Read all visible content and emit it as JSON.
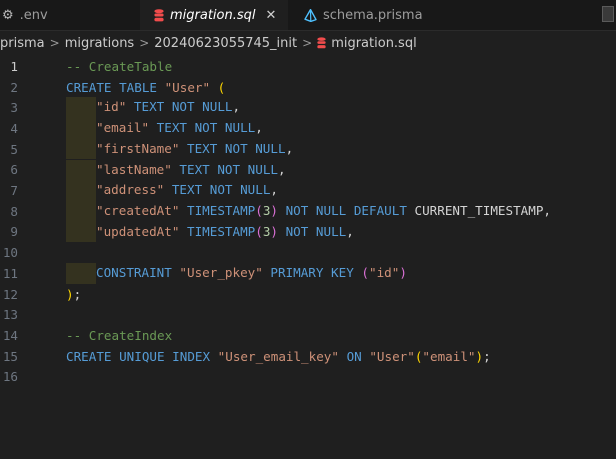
{
  "tabs": [
    {
      "label": ".env",
      "icon": "gear-icon",
      "active": false
    },
    {
      "label": "migration.sql",
      "icon": "database-icon",
      "active": true,
      "close": "✕"
    },
    {
      "label": "schema.prisma",
      "icon": "prisma-icon",
      "active": false
    }
  ],
  "breadcrumb": {
    "items": [
      "prisma",
      "migrations",
      "20240623055745_init",
      "migration.sql"
    ],
    "separator": ">"
  },
  "colors": {
    "keyword": "#569cd6",
    "string": "#ce9178",
    "comment": "#6a9955",
    "bracket": "#ffd700",
    "db_icon": "#f14c4c",
    "prisma_icon": "#4fc1ff"
  },
  "editor": {
    "current_line": 1,
    "lines": [
      {
        "n": "1",
        "tokens": [
          [
            "-- CreateTable",
            "comment"
          ]
        ]
      },
      {
        "n": "2",
        "tokens": [
          [
            "CREATE TABLE ",
            "kw"
          ],
          [
            "\"User\"",
            "str"
          ],
          [
            " ",
            "plain"
          ],
          [
            "(",
            "paren"
          ]
        ]
      },
      {
        "n": "3",
        "indent": true,
        "tokens": [
          [
            "\"id\"",
            "str"
          ],
          [
            " TEXT NOT NULL",
            "kw"
          ],
          [
            ",",
            "plain"
          ]
        ]
      },
      {
        "n": "4",
        "indent": true,
        "tokens": [
          [
            "\"email\"",
            "str"
          ],
          [
            " TEXT NOT NULL",
            "kw"
          ],
          [
            ",",
            "plain"
          ]
        ]
      },
      {
        "n": "5",
        "indent": true,
        "tokens": [
          [
            "\"firstName\"",
            "str"
          ],
          [
            " TEXT NOT NULL",
            "kw"
          ],
          [
            ",",
            "plain"
          ]
        ]
      },
      {
        "n": "6",
        "indent": true,
        "tokens": [
          [
            "\"lastName\"",
            "str"
          ],
          [
            " TEXT NOT NULL",
            "kw"
          ],
          [
            ",",
            "plain"
          ]
        ]
      },
      {
        "n": "7",
        "indent": true,
        "tokens": [
          [
            "\"address\"",
            "str"
          ],
          [
            " TEXT NOT NULL",
            "kw"
          ],
          [
            ",",
            "plain"
          ]
        ]
      },
      {
        "n": "8",
        "indent": true,
        "tokens": [
          [
            "\"createdAt\"",
            "str"
          ],
          [
            " TIMESTAMP",
            "kw"
          ],
          [
            "(",
            "paren2"
          ],
          [
            "3",
            "num"
          ],
          [
            ")",
            "paren2"
          ],
          [
            " NOT NULL DEFAULT ",
            "kw"
          ],
          [
            "CURRENT_TIMESTAMP",
            "plain"
          ],
          [
            ",",
            "plain"
          ]
        ]
      },
      {
        "n": "9",
        "indent": true,
        "tokens": [
          [
            "\"updatedAt\"",
            "str"
          ],
          [
            " TIMESTAMP",
            "kw"
          ],
          [
            "(",
            "paren2"
          ],
          [
            "3",
            "num"
          ],
          [
            ")",
            "paren2"
          ],
          [
            " NOT NULL",
            "kw"
          ],
          [
            ",",
            "plain"
          ]
        ]
      },
      {
        "n": "10",
        "tokens": []
      },
      {
        "n": "11",
        "indent": true,
        "tokens": [
          [
            "CONSTRAINT ",
            "kw"
          ],
          [
            "\"User_pkey\"",
            "str"
          ],
          [
            " PRIMARY KEY ",
            "kw"
          ],
          [
            "(",
            "paren2"
          ],
          [
            "\"id\"",
            "str"
          ],
          [
            ")",
            "paren2"
          ]
        ]
      },
      {
        "n": "12",
        "tokens": [
          [
            ")",
            "paren"
          ],
          [
            ";",
            "plain"
          ]
        ]
      },
      {
        "n": "13",
        "tokens": []
      },
      {
        "n": "14",
        "tokens": [
          [
            "-- CreateIndex",
            "comment"
          ]
        ]
      },
      {
        "n": "15",
        "tokens": [
          [
            "CREATE UNIQUE INDEX ",
            "kw"
          ],
          [
            "\"User_email_key\"",
            "str"
          ],
          [
            " ON ",
            "kw"
          ],
          [
            "\"User\"",
            "str"
          ],
          [
            "(",
            "paren"
          ],
          [
            "\"email\"",
            "str"
          ],
          [
            ")",
            "paren"
          ],
          [
            ";",
            "plain"
          ]
        ]
      },
      {
        "n": "16",
        "tokens": []
      }
    ]
  }
}
